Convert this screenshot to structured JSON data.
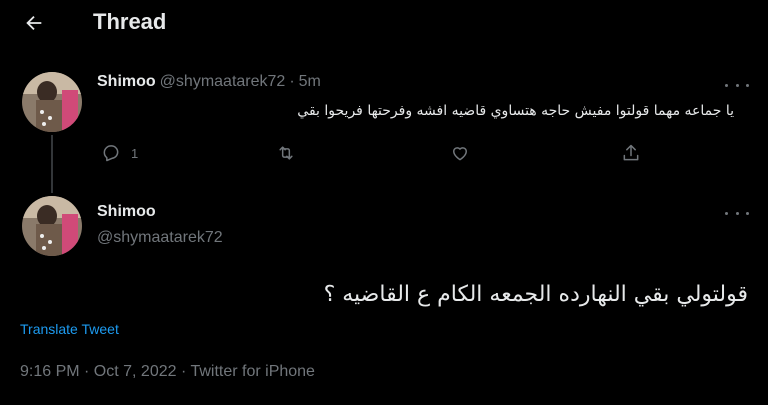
{
  "header": {
    "title": "Thread",
    "back_icon": "arrow-left-icon"
  },
  "colors": {
    "background": "#000000",
    "text": "#e7e9ea",
    "muted": "#71767b",
    "accent": "#1d9bf0",
    "line": "#333639"
  },
  "reply_tweet": {
    "name": "Shimoo",
    "handle": "@shymaatarek72",
    "separator": "·",
    "time": "5m",
    "text": "يا جماعه مهما قولتوا مفيش حاجه هتساوي قاضيه افشه وفرحتها فريحوا بقي",
    "actions": {
      "reply_count": "1",
      "reply_icon": "comment-icon",
      "retweet_icon": "retweet-icon",
      "like_icon": "heart-icon",
      "share_icon": "share-icon"
    }
  },
  "main_tweet": {
    "name": "Shimoo",
    "handle": "@shymaatarek72",
    "text": "قولتولي بقي النهارده الجمعه الكام ع القاضيه ؟",
    "translate_label": "Translate Tweet",
    "meta": "9:16 PM · Oct 7, 2022 · Twitter for iPhone"
  }
}
